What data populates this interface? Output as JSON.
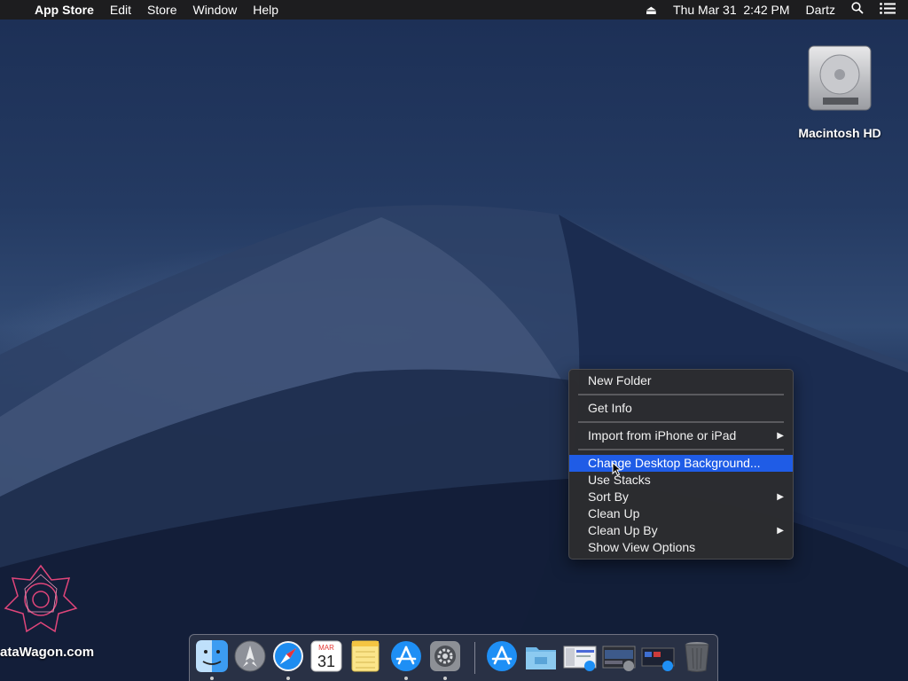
{
  "menubar": {
    "apple_glyph": "",
    "app_name": "App Store",
    "menus": [
      "Edit",
      "Store",
      "Window",
      "Help"
    ],
    "status": {
      "eject_glyph": "⏏",
      "datetime": "Thu Mar 31  2:42 PM",
      "user": "Dartz"
    }
  },
  "desktop": {
    "drive_label": "Macintosh HD",
    "watermark": "ataWagon.com"
  },
  "context_menu": {
    "items": [
      {
        "label": "New Folder"
      },
      {
        "label": "Get Info"
      },
      {
        "label": "Import from iPhone or iPad",
        "submenu": true
      },
      {
        "label": "Change Desktop Background...",
        "selected": true
      },
      {
        "label": "Use Stacks"
      },
      {
        "label": "Sort By",
        "submenu": true
      },
      {
        "label": "Clean Up"
      },
      {
        "label": "Clean Up By",
        "submenu": true
      },
      {
        "label": "Show View Options"
      }
    ],
    "submenu_glyph": "▶"
  },
  "dock": {
    "apps": [
      {
        "name": "Finder",
        "icon": "finder-icon",
        "running": true
      },
      {
        "name": "Launchpad",
        "icon": "launchpad-icon",
        "running": false
      },
      {
        "name": "Safari",
        "icon": "safari-icon",
        "running": true
      },
      {
        "name": "Calendar",
        "icon": "calendar-icon",
        "running": false,
        "month": "MAR",
        "day": "31"
      },
      {
        "name": "Notes",
        "icon": "notes-icon",
        "running": false
      },
      {
        "name": "App Store",
        "icon": "app-store-icon",
        "running": true
      },
      {
        "name": "System Preferences",
        "icon": "system-preferences-icon",
        "running": true
      }
    ],
    "others": [
      {
        "name": "Applications",
        "icon": "applications-folder-icon"
      },
      {
        "name": "Documents",
        "icon": "documents-folder-icon"
      },
      {
        "name": "Screenshot 1",
        "icon": "screenshot-thumbnail-icon"
      },
      {
        "name": "Screenshot 2",
        "icon": "screenshot-thumbnail-icon"
      },
      {
        "name": "Screenshot 3",
        "icon": "screenshot-thumbnail-icon"
      },
      {
        "name": "Trash",
        "icon": "trash-icon"
      }
    ]
  },
  "colors": {
    "menu_highlight": "#1f5ce6",
    "menubar_bg": "#1d1d1f"
  }
}
